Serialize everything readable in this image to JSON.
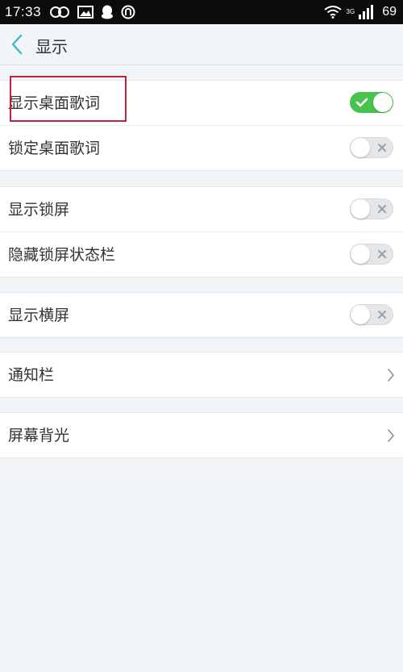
{
  "status_bar": {
    "time": "17:33",
    "network": "3G",
    "battery": "69",
    "left_icons": [
      "infinity-loop-icon",
      "image-icon",
      "qq-penguin-icon",
      "at-sign-icon"
    ],
    "right_icons": [
      "wifi-icon",
      "signal-bars-icon"
    ]
  },
  "header": {
    "back_icon": "chevron-left-icon",
    "title": "显示"
  },
  "colors": {
    "accent": "#49c24f",
    "back_arrow": "#3fb5c8",
    "highlight_box": "#c0213f",
    "background": "#f1f5f7"
  },
  "settings": {
    "show_desktop_lyrics": {
      "label": "显示桌面歌词",
      "on": true
    },
    "lock_desktop_lyrics": {
      "label": "锁定桌面歌词",
      "on": false
    },
    "show_lockscreen": {
      "label": "显示锁屏",
      "on": false
    },
    "hide_lockscreen_statusbar": {
      "label": "隐藏锁屏状态栏",
      "on": false
    },
    "show_landscape": {
      "label": "显示横屏",
      "on": false
    },
    "notification_bar": {
      "label": "通知栏"
    },
    "screen_backlight": {
      "label": "屏幕背光"
    }
  }
}
